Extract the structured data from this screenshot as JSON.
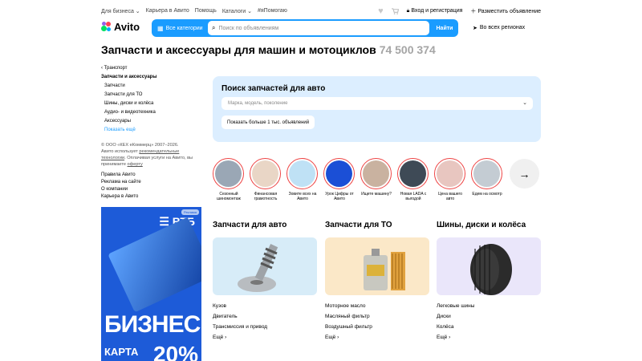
{
  "topnav": {
    "links": [
      "Для бизнеса",
      "Карьера в Авито",
      "Помощь",
      "Каталоги",
      "#яПомогаю"
    ],
    "login": "Вход и регистрация",
    "post_ad": "Разместить объявление"
  },
  "header": {
    "logo": "Avito",
    "all_categories": "Все категории",
    "search_placeholder": "Поиск по объявлениям",
    "search_button": "Найти",
    "region": "Во всех регионах"
  },
  "page": {
    "title": "Запчасти и аксессуары для машин и мотоциклов",
    "count": "74 500 374"
  },
  "sidebar": {
    "crumb": "Транспорт",
    "active": "Запчасти и аксессуары",
    "items": [
      "Запчасти",
      "Запчасти для ТО",
      "Шины, диски и колёса",
      "Аудио- и видеотехника",
      "Аксессуары"
    ],
    "more": "Показать ещё",
    "legal_1": "© ООО «КЕХ еКоммерц» 2007–2026.",
    "legal_2": "Авито использует",
    "legal_link_1": "рекомендательные технологии",
    "legal_3": ". Оплачивая услуги на Авито, вы принимаете",
    "legal_link_2": "оферту",
    "links": [
      "Правила Авито",
      "Реклама на сайте",
      "О компании",
      "Карьера в Авито"
    ]
  },
  "banner": {
    "ad_label": "Реклама",
    "brand": "ВТБ",
    "line1": "БИЗНЕС",
    "line2": "КАРТА",
    "pct": "20%"
  },
  "search_panel": {
    "title": "Поиск запчастей для авто",
    "field_placeholder": "Марка, модель, поколение",
    "show_more": "Показать больше 1 тыс. объявлений"
  },
  "stories": [
    {
      "caption": "Сезонный шиномонтаж",
      "color": "#9aa7b5"
    },
    {
      "caption": "Финансовая грамотность",
      "color": "#e9d6c6"
    },
    {
      "caption": "Зовите всех на Авито",
      "color": "#bfe1f5"
    },
    {
      "caption": "Урок Цифры от Авито",
      "color": "#1b4fd6"
    },
    {
      "caption": "Ищете машину?",
      "color": "#c9b2a0"
    },
    {
      "caption": "Новая LADA с выгодой",
      "color": "#3e4a56"
    },
    {
      "caption": "Цена вашего авто",
      "color": "#e8c6c0"
    },
    {
      "caption": "Едем на осмотр",
      "color": "#c4ccd3"
    }
  ],
  "categories": [
    {
      "title": "Запчасти для авто",
      "bg": "#d7ecf8",
      "subs": [
        "Кузов",
        "Двигатель",
        "Трансмиссия и привод",
        "Ещё"
      ]
    },
    {
      "title": "Запчасти для ТО",
      "bg": "#fbe8c8",
      "subs": [
        "Моторное масло",
        "Масляный фильтр",
        "Воздушный фильтр",
        "Ещё"
      ]
    },
    {
      "title": "Шины, диски и колёса",
      "bg": "#eae6fa",
      "subs": [
        "Легковые шины",
        "Диски",
        "Колёса",
        "Ещё"
      ]
    }
  ]
}
